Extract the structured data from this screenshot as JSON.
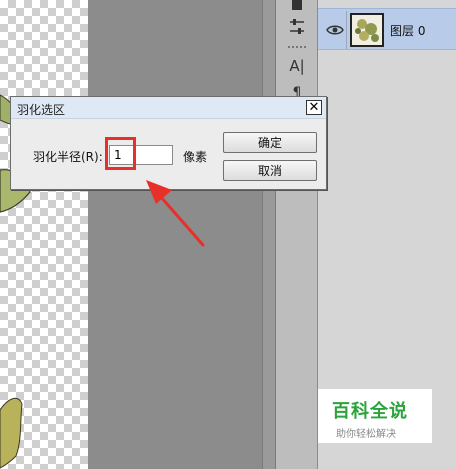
{
  "dialog": {
    "title": "羽化选区",
    "close_glyph": "✕",
    "feather_label": "羽化半径(R):",
    "feather_value": "1",
    "unit": "像素",
    "ok_label": "确定",
    "cancel_label": "取消"
  },
  "tools": {
    "text_tool_glyph": "A|",
    "paragraph_tool_glyph": "¶",
    "adjust_tool_glyph": "⚟"
  },
  "layers": {
    "items": [
      {
        "name": "图层 0",
        "visible": true,
        "selected": true
      }
    ]
  },
  "watermark": {
    "title": "百科全说",
    "subtitle": "助你轻松解决"
  },
  "colors": {
    "highlight": "#e8302a",
    "selected_layer": "#b8cbe8",
    "watermark_green": "#2aa43a"
  }
}
